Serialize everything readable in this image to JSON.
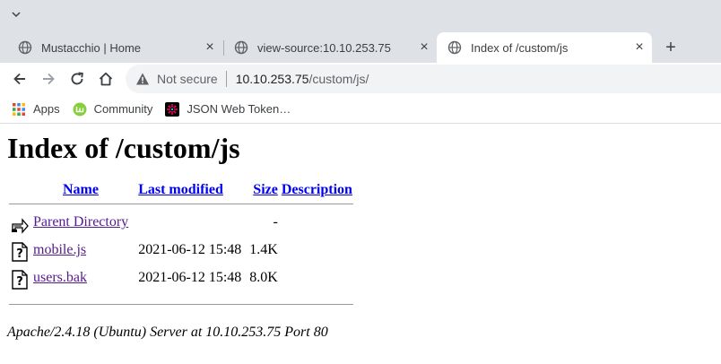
{
  "tabs": [
    {
      "title": "Mustacchio | Home",
      "active": false
    },
    {
      "title": "view-source:10.10.253.75",
      "active": false
    },
    {
      "title": "Index of /custom/js",
      "active": true
    }
  ],
  "omnibox": {
    "security": "Not secure",
    "host": "10.10.253.75",
    "path": "/custom/js/"
  },
  "bookmarks": [
    {
      "label": "Apps",
      "icon": "apps-grid-icon"
    },
    {
      "label": "Community",
      "icon": "linux-mint-icon"
    },
    {
      "label": "JSON Web Token…",
      "icon": "jwt-icon"
    }
  ],
  "page": {
    "heading": "Index of /custom/js",
    "columns": {
      "name": "Name",
      "modified": "Last modified",
      "size": "Size",
      "description": "Description"
    },
    "parent": {
      "label": "Parent Directory",
      "size": "-"
    },
    "files": [
      {
        "name": "mobile.js",
        "modified": "2021-06-12 15:48",
        "size": "1.4K",
        "icon": "unknown-file-icon"
      },
      {
        "name": "users.bak",
        "modified": "2021-06-12 15:48",
        "size": "8.0K",
        "icon": "unknown-file-icon"
      }
    ],
    "footer": "Apache/2.4.18 (Ubuntu) Server at 10.10.253.75 Port 80"
  }
}
